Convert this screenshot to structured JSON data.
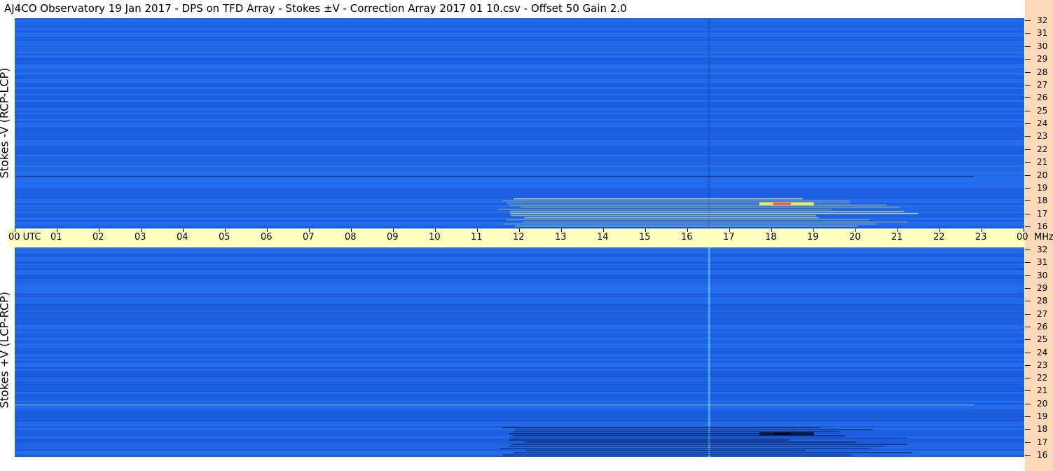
{
  "header": {
    "title": "AJ4CO Observatory  19 Jan 2017  -  DPS on TFD Array  -  Stokes ±V  -  Correction Array 2017 01 10.csv  -  Offset 50  Gain 2.0"
  },
  "panels": [
    {
      "label": "Stokes -V (RCP-LCP)"
    },
    {
      "label": "Stokes +V (LCP-RCP)"
    }
  ],
  "time_axis": {
    "labels": [
      "00 UTC",
      "01",
      "02",
      "03",
      "04",
      "05",
      "06",
      "07",
      "08",
      "09",
      "10",
      "11",
      "12",
      "13",
      "14",
      "15",
      "16",
      "17",
      "18",
      "19",
      "20",
      "21",
      "22",
      "23",
      "00"
    ],
    "unit": "MHz"
  },
  "freq_axis": {
    "labels": [
      "32",
      "31",
      "30",
      "29",
      "28",
      "27",
      "26",
      "25",
      "24",
      "23",
      "22",
      "21",
      "20",
      "19",
      "18",
      "17",
      "16"
    ]
  },
  "colors": {
    "background_blue": "#1f63e8",
    "band_dark": "#1650c8",
    "band_light": "#2c7af0",
    "axis_band": "#ffffc0",
    "right_strip": "#fad8b8",
    "burst_yellow": "#f2f26a",
    "burst_red": "#ff3050",
    "burst_dark": "#061640"
  },
  "chart_data": {
    "type": "heatmap",
    "title": "AJ4CO Observatory  19 Jan 2017  -  DPS on TFD Array  -  Stokes ±V  -  Correction Array 2017 01 10.csv  -  Offset 50  Gain 2.0",
    "x": {
      "label": "UTC",
      "range": [
        0,
        24
      ]
    },
    "y": {
      "label": "MHz",
      "range": [
        16,
        32
      ]
    },
    "panels": [
      {
        "name": "Stokes -V (RCP-LCP)",
        "features": [
          {
            "kind": "storm",
            "time_start": 11.5,
            "time_end": 21.5,
            "freq_low": 16.2,
            "freq_high": 18.3
          },
          {
            "kind": "burst",
            "time_start": 17.7,
            "time_end": 19.0,
            "freq": 17.9
          }
        ]
      },
      {
        "name": "Stokes +V (LCP-RCP)",
        "features": [
          {
            "kind": "storm",
            "time_start": 11.5,
            "time_end": 21.5,
            "freq_low": 16.2,
            "freq_high": 18.3
          },
          {
            "kind": "burst",
            "time_start": 17.7,
            "time_end": 19.0,
            "freq": 17.8
          }
        ]
      }
    ]
  }
}
